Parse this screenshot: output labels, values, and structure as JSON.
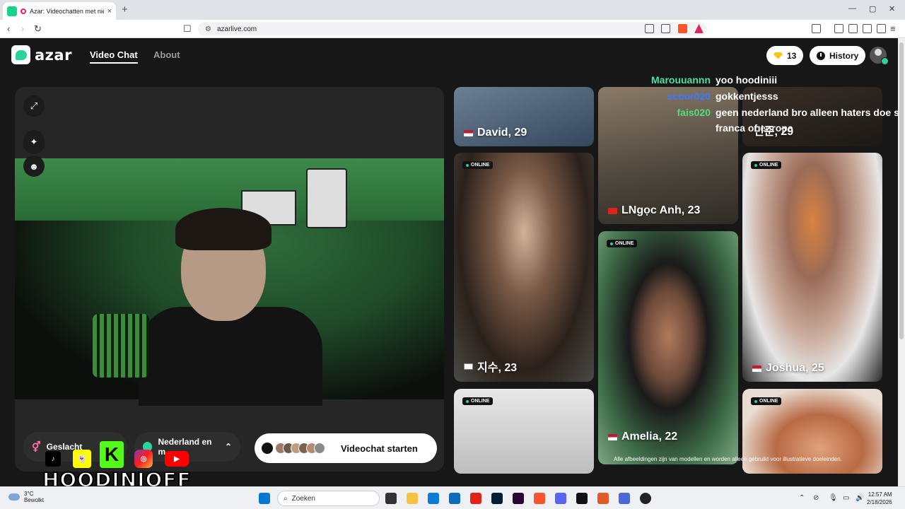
{
  "browser": {
    "tab_title": "Azar: Videochatten met nieuw",
    "tab_close": "×",
    "new_tab": "+",
    "url": "azarlive.com",
    "window_controls": [
      "—",
      "▢",
      "✕"
    ]
  },
  "header": {
    "logo_text": "azar",
    "nav": [
      {
        "label": "Video Chat",
        "active": true
      },
      {
        "label": "About",
        "active": false
      }
    ],
    "gems_count": "13",
    "history_label": "History"
  },
  "video_panel": {
    "gender_label": "Geslacht",
    "region_label": "Nederland en m",
    "start_label": "Videochat starten"
  },
  "gallery": {
    "online_badge": "ONLINE",
    "cards": [
      {
        "name": "David, 29",
        "flag": "us"
      },
      {
        "name": "LNgọc Anh, 23",
        "flag": "vn"
      },
      {
        "name": "지수, 23",
        "flag": "kr"
      },
      {
        "name": "Joshua, 25",
        "flag": "us"
      },
      {
        "name": "Amelia, 22",
        "flag": "us"
      },
      {
        "name": "민준, 29",
        "flag": "kr"
      }
    ],
    "disclaimer": "Alle afbeeldingen zijn van modellen en worden alleen gebruikt voor illustratieve doeleinden."
  },
  "chat": [
    {
      "user": "Marouuannn",
      "message": "yoo hoodiniii",
      "color": "#4de0a0"
    },
    {
      "user": "scoor020",
      "message": "gokkentjesss",
      "color": "#3a7bff"
    },
    {
      "user": "fais020",
      "message": "geen nederland bro alleen haters doe sh",
      "color": "#4de07a"
    },
    {
      "user": "",
      "message": "franca of europe",
      "color": "#ffffff"
    }
  ],
  "overlay": {
    "streamer_name": "HOODINIOFF"
  },
  "taskbar": {
    "temperature": "3°C",
    "weather": "Bewolkt",
    "search_placeholder": "Zoeken",
    "time": "12:57 AM",
    "date": "2/18/2026"
  },
  "colors": {
    "accent": "#2ad39a",
    "page_bg": "#171717",
    "gem": "#f5c518"
  }
}
